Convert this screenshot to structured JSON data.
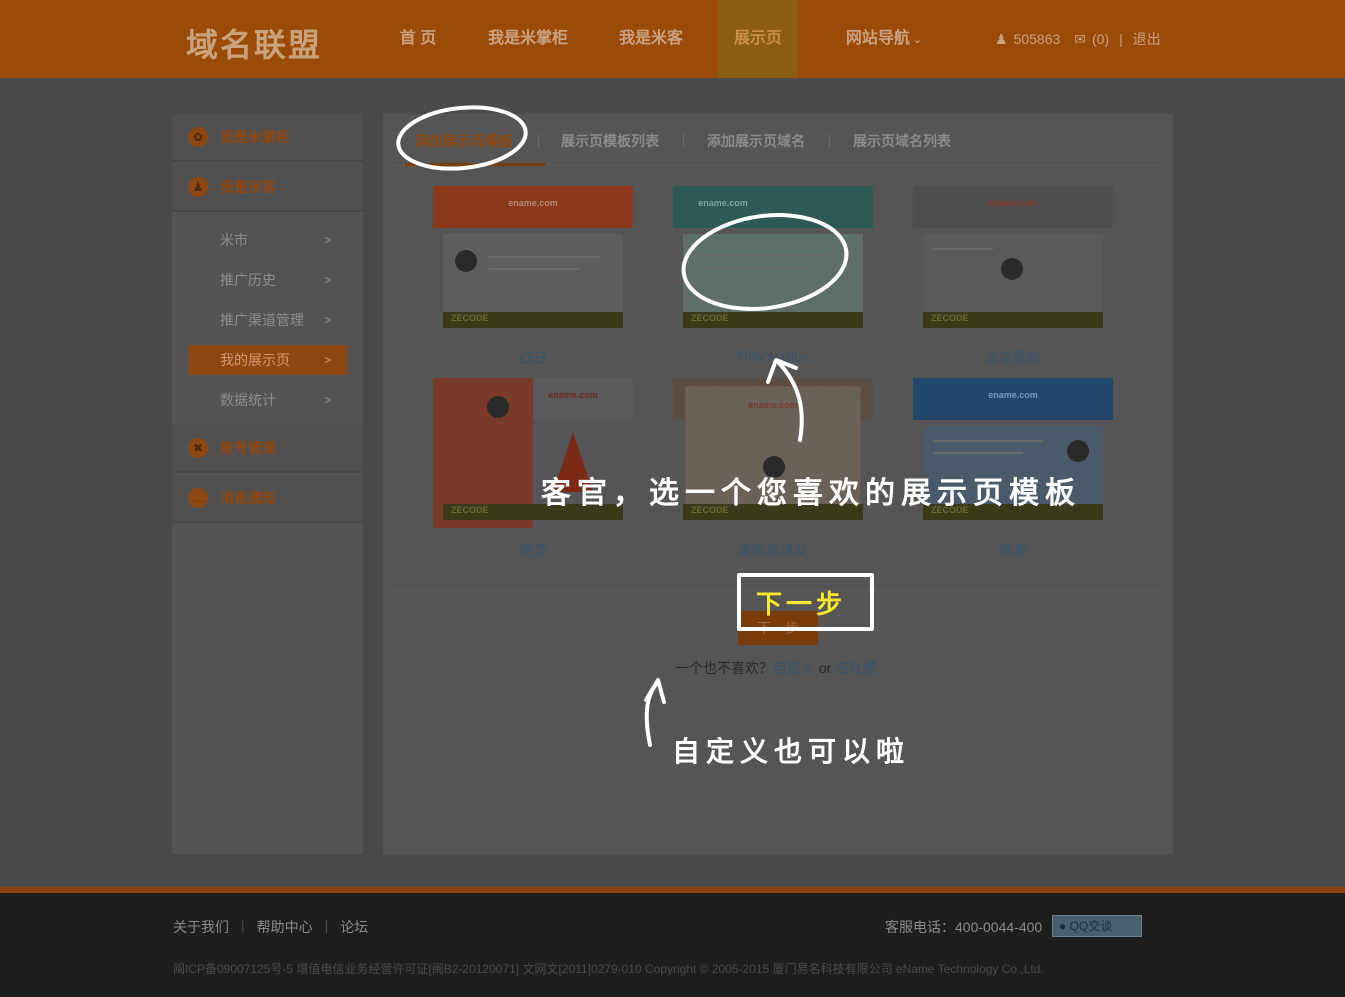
{
  "header": {
    "logo": "域名联盟",
    "nav": [
      {
        "label": "首 页"
      },
      {
        "label": "我是米掌柜"
      },
      {
        "label": "我是米客"
      },
      {
        "label": "展示页"
      },
      {
        "label": "网站导航"
      }
    ],
    "user": {
      "id": "505863",
      "messages": "(0)",
      "logout": "退出"
    }
  },
  "sidebar": {
    "groups": [
      {
        "label": "我是米掌柜",
        "icon": "leaf-icon"
      },
      {
        "label": "我是米客",
        "icon": "user-icon"
      },
      {
        "label": "账号管理",
        "icon": "tools-icon"
      },
      {
        "label": "消息通知",
        "icon": "chat-icon"
      }
    ],
    "items": [
      {
        "label": "米市",
        "arrow": ">"
      },
      {
        "label": "推广历史",
        "arrow": ">"
      },
      {
        "label": "推广渠道管理",
        "arrow": ">"
      },
      {
        "label": "我的展示页",
        "arrow": ">"
      },
      {
        "label": "数据统计",
        "arrow": ">"
      }
    ]
  },
  "main": {
    "tabs": [
      {
        "label": "添加展示页模板"
      },
      {
        "label": "展示页模板列表"
      },
      {
        "label": "添加展示页域名"
      },
      {
        "label": "展示页域名列表"
      }
    ],
    "templates": [
      {
        "name": "红日",
        "domain": "ename.com",
        "head_color": "#8a3a1a",
        "body_color": "#5a5a5a"
      },
      {
        "name": "Tiffany Blue",
        "domain": "ename.com",
        "head_color": "#2e5a55",
        "body_color": "#5e6e6a"
      },
      {
        "name": "墨染雾松",
        "domain": "ename.com",
        "head_color": "#555555",
        "body_color": "#5a5a5a"
      },
      {
        "name": "便签",
        "domain": "ename.com",
        "head_color": "#7a3a2a",
        "body_color": "#5a4a44"
      },
      {
        "name": "集邮发烧友",
        "domain": "ename.com",
        "head_color": "#6a5a4a",
        "body_color": "#6a6258"
      },
      {
        "name": "童趣",
        "domain": "ename.com",
        "head_color": "#2a4a6a",
        "body_color": "#4a5a6a"
      }
    ],
    "next_button": "下一步",
    "alt": {
      "prefix": "一个也不喜欢？",
      "custom": "自定义",
      "or": " or ",
      "complain": "去吐槽"
    }
  },
  "annotations": {
    "main": "客官，选一个您喜欢的展示页模板",
    "next": "下一步",
    "custom": "自定义也可以啦"
  },
  "footer": {
    "links": [
      "关于我们",
      "帮助中心",
      "论坛"
    ],
    "phone": "客服电话：400-0044-400",
    "qq": "QQ交谈",
    "copyright": "闽ICP备09007125号-5 增值电信业务经营许可证[闽B2-20120071] 文网文[2011]0279-010 Copyright © 2005-2015 厦门易名科技有限公司 eName Technology Co.,Ltd."
  },
  "colors": {
    "accent": "#c86510",
    "overlay_dim": "#4a4a4a"
  }
}
